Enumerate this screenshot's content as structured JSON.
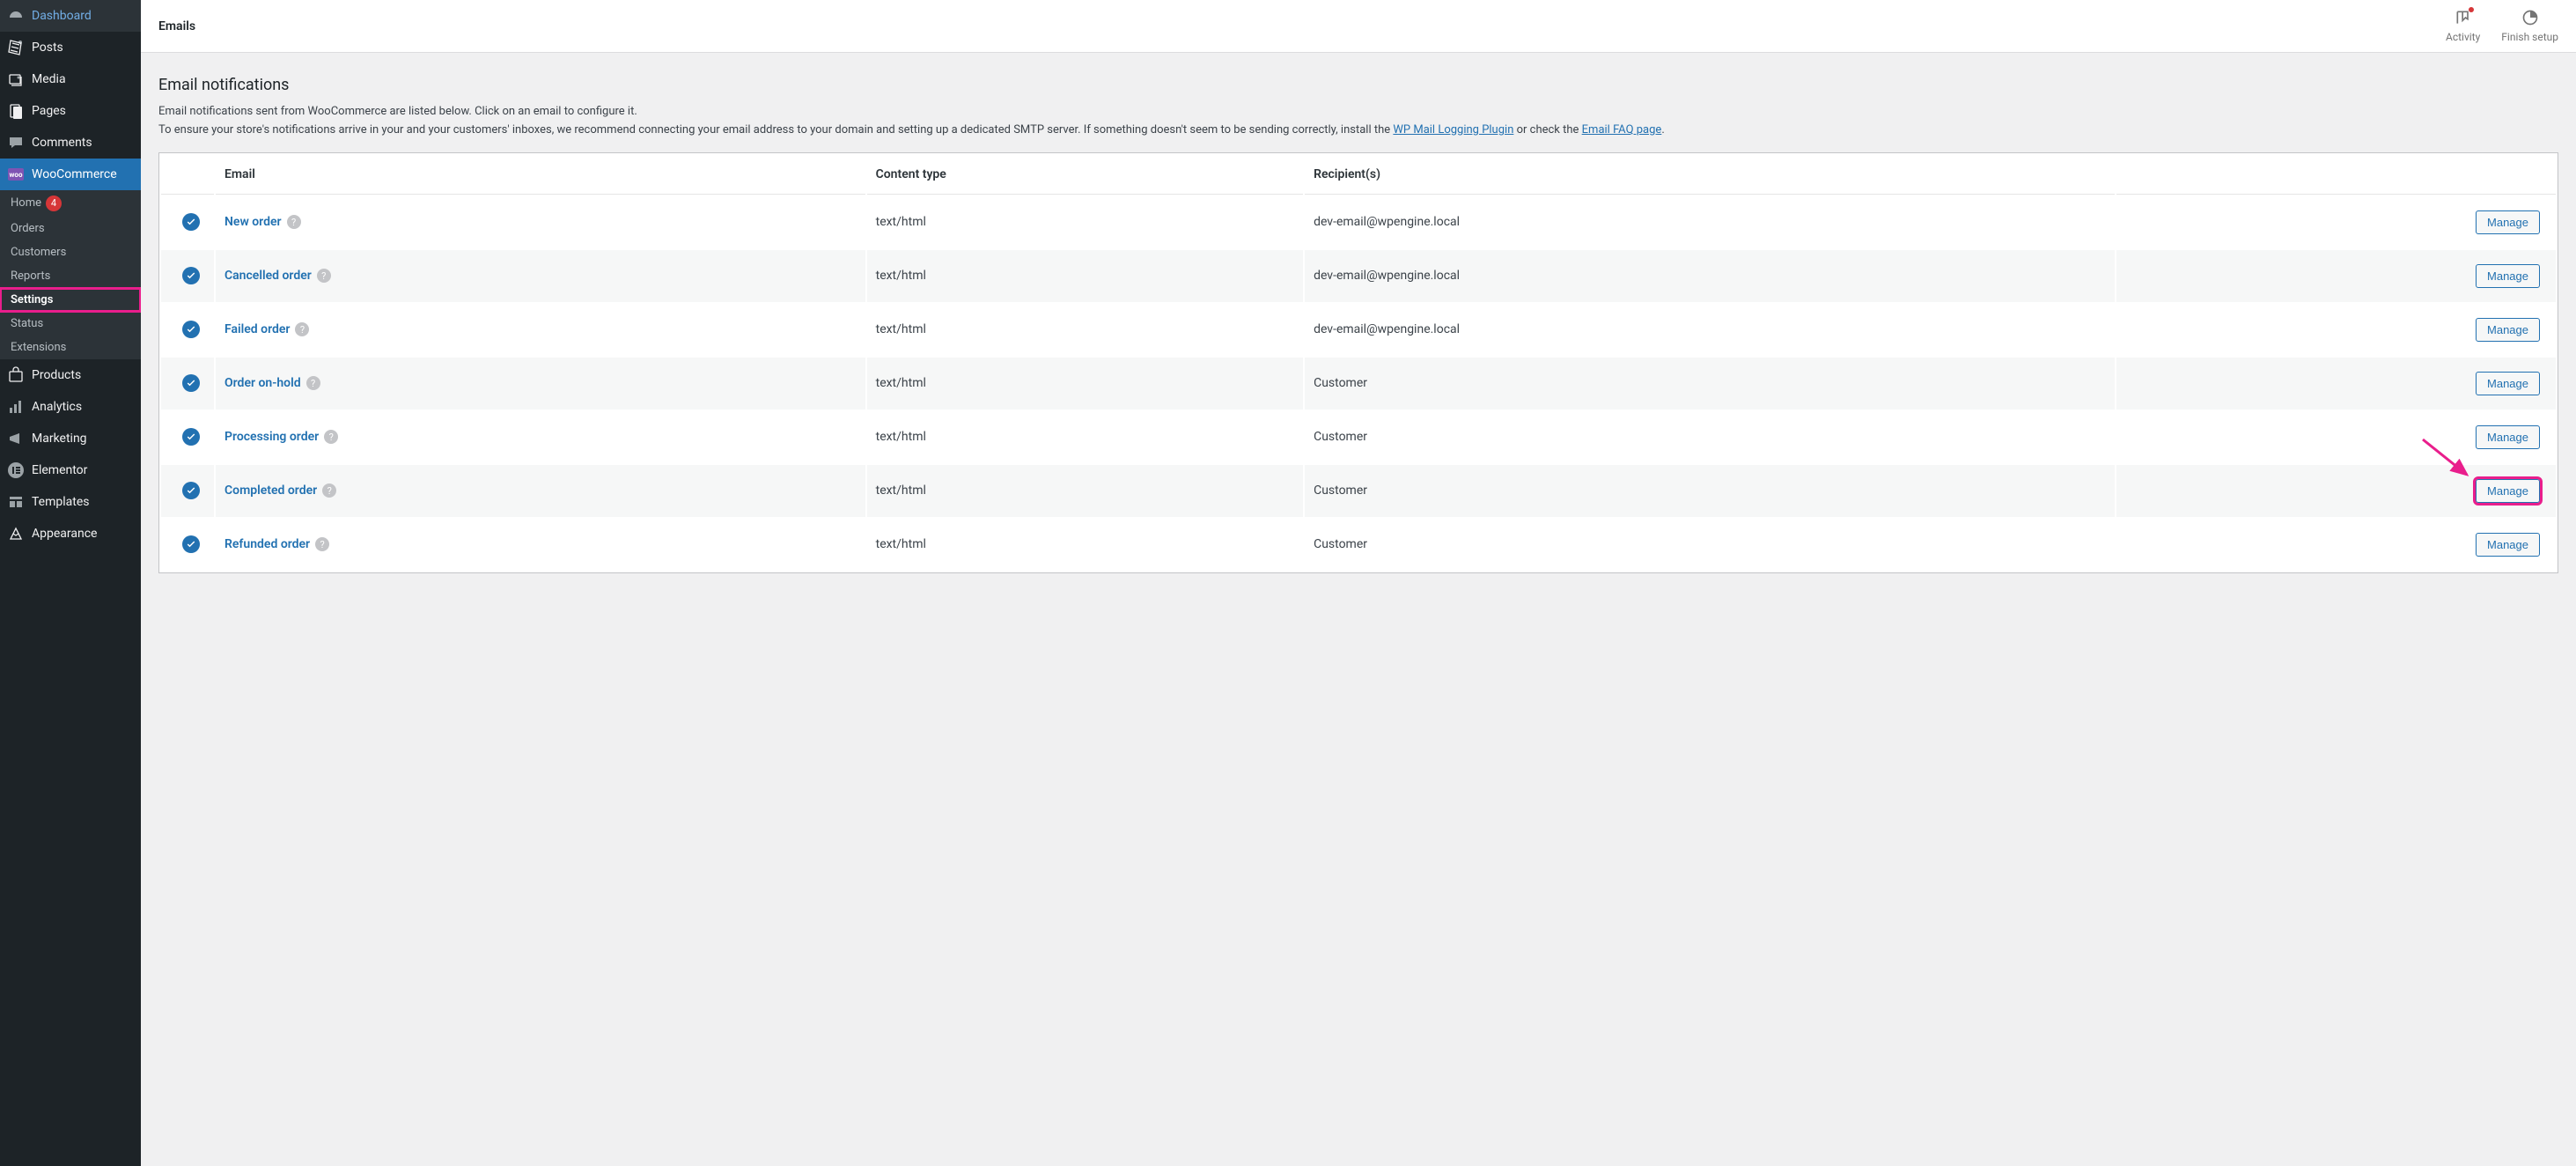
{
  "topbar": {
    "title": "Emails",
    "activity_label": "Activity",
    "finish_label": "Finish setup"
  },
  "sidebar": {
    "items": [
      {
        "icon": "dashboard",
        "label": "Dashboard"
      },
      {
        "icon": "posts",
        "label": "Posts"
      },
      {
        "icon": "media",
        "label": "Media"
      },
      {
        "icon": "pages",
        "label": "Pages"
      },
      {
        "icon": "comments",
        "label": "Comments"
      },
      {
        "icon": "woo",
        "label": "WooCommerce",
        "active": true
      },
      {
        "icon": "products",
        "label": "Products"
      },
      {
        "icon": "analytics",
        "label": "Analytics"
      },
      {
        "icon": "marketing",
        "label": "Marketing"
      },
      {
        "icon": "elementor",
        "label": "Elementor"
      },
      {
        "icon": "templates",
        "label": "Templates"
      },
      {
        "icon": "appearance",
        "label": "Appearance"
      }
    ],
    "submenu": [
      {
        "label": "Home",
        "badge": "4"
      },
      {
        "label": "Orders"
      },
      {
        "label": "Customers"
      },
      {
        "label": "Reports"
      },
      {
        "label": "Settings",
        "highlighted": true
      },
      {
        "label": "Status"
      },
      {
        "label": "Extensions"
      }
    ]
  },
  "section": {
    "title": "Email notifications",
    "desc_line1": "Email notifications sent from WooCommerce are listed below. Click on an email to configure it.",
    "desc_line2_a": "To ensure your store's notifications arrive in your and your customers' inboxes, we recommend connecting your email address to your domain and setting up a dedicated SMTP server. If something doesn't seem to be sending correctly, install the ",
    "link1": "WP Mail Logging Plugin",
    "desc_line2_b": " or check the ",
    "link2": "Email FAQ page",
    "desc_line2_c": "."
  },
  "table": {
    "headers": {
      "status": "",
      "email": "Email",
      "content_type": "Content type",
      "recipients": "Recipient(s)",
      "actions": ""
    },
    "manage_label": "Manage",
    "rows": [
      {
        "name": "New order",
        "content_type": "text/html",
        "recipients": "dev-email@wpengine.local",
        "enabled": true
      },
      {
        "name": "Cancelled order",
        "content_type": "text/html",
        "recipients": "dev-email@wpengine.local",
        "enabled": true
      },
      {
        "name": "Failed order",
        "content_type": "text/html",
        "recipients": "dev-email@wpengine.local",
        "enabled": true
      },
      {
        "name": "Order on-hold",
        "content_type": "text/html",
        "recipients": "Customer",
        "enabled": true
      },
      {
        "name": "Processing order",
        "content_type": "text/html",
        "recipients": "Customer",
        "enabled": true
      },
      {
        "name": "Completed order",
        "content_type": "text/html",
        "recipients": "Customer",
        "enabled": true,
        "highlighted": true
      },
      {
        "name": "Refunded order",
        "content_type": "text/html",
        "recipients": "Customer",
        "enabled": true
      }
    ]
  },
  "annotation": {
    "arrow_color": "#e91e8c"
  }
}
